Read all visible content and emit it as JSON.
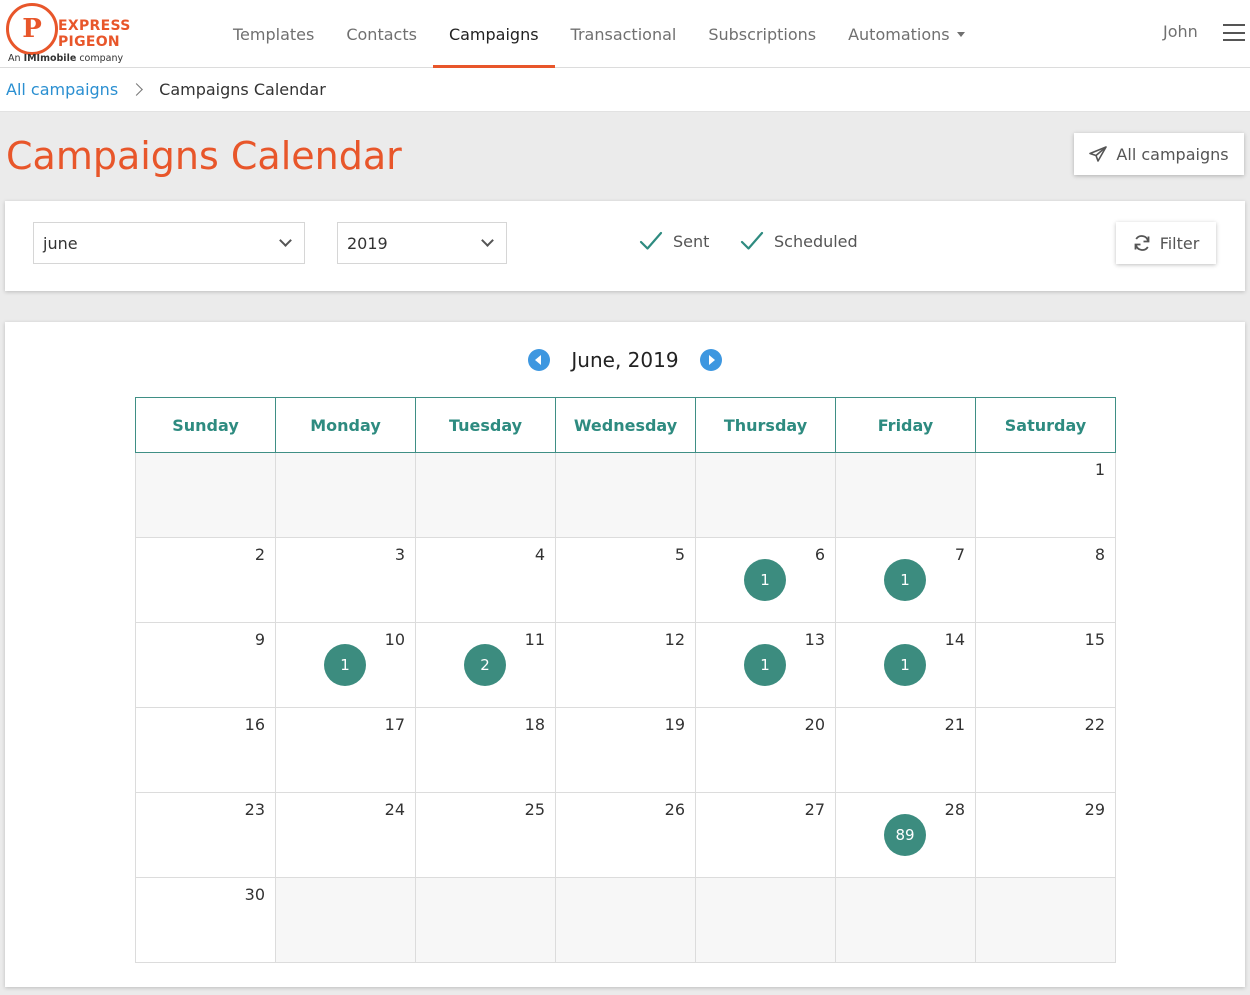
{
  "brand": {
    "logo_letter": "P",
    "line1": "EXPRESS",
    "line2": "PIGEON",
    "sub_prefix": "An",
    "sub_strong": "IMImobile",
    "sub_suffix": "company"
  },
  "nav": {
    "items": [
      {
        "label": "Templates",
        "active": false
      },
      {
        "label": "Contacts",
        "active": false
      },
      {
        "label": "Campaigns",
        "active": true
      },
      {
        "label": "Transactional",
        "active": false
      },
      {
        "label": "Subscriptions",
        "active": false
      },
      {
        "label": "Automations",
        "active": false,
        "dropdown": true
      }
    ],
    "user": "John"
  },
  "breadcrumb": {
    "link": "All campaigns",
    "current": "Campaigns Calendar"
  },
  "page": {
    "title": "Campaigns Calendar",
    "all_campaigns_button": "All campaigns"
  },
  "filters": {
    "month": "june",
    "year": "2019",
    "sent_label": "Sent",
    "sent_checked": true,
    "scheduled_label": "Scheduled",
    "scheduled_checked": true,
    "filter_button": "Filter"
  },
  "calendar": {
    "month_label": "June, 2019",
    "weekdays": [
      "Sunday",
      "Monday",
      "Tuesday",
      "Wednesday",
      "Thursday",
      "Friday",
      "Saturday"
    ],
    "weeks": [
      [
        null,
        null,
        null,
        null,
        null,
        null,
        {
          "day": "1"
        }
      ],
      [
        {
          "day": "2"
        },
        {
          "day": "3"
        },
        {
          "day": "4"
        },
        {
          "day": "5"
        },
        {
          "day": "6",
          "count": "1"
        },
        {
          "day": "7",
          "count": "1"
        },
        {
          "day": "8"
        }
      ],
      [
        {
          "day": "9"
        },
        {
          "day": "10",
          "count": "1"
        },
        {
          "day": "11",
          "count": "2"
        },
        {
          "day": "12"
        },
        {
          "day": "13",
          "count": "1"
        },
        {
          "day": "14",
          "count": "1"
        },
        {
          "day": "15"
        }
      ],
      [
        {
          "day": "16"
        },
        {
          "day": "17"
        },
        {
          "day": "18"
        },
        {
          "day": "19"
        },
        {
          "day": "20"
        },
        {
          "day": "21"
        },
        {
          "day": "22"
        }
      ],
      [
        {
          "day": "23"
        },
        {
          "day": "24"
        },
        {
          "day": "25"
        },
        {
          "day": "26"
        },
        {
          "day": "27"
        },
        {
          "day": "28",
          "count": "89"
        },
        {
          "day": "29"
        }
      ],
      [
        {
          "day": "30"
        },
        null,
        null,
        null,
        null,
        null,
        null
      ]
    ]
  },
  "colors": {
    "brand_orange": "#e8562a",
    "teal": "#3c8c7f",
    "link_blue": "#2a8fd1",
    "arrow_blue": "#3d97e0"
  },
  "icons": {
    "prev": "chevron-left-circle-icon",
    "next": "chevron-right-circle-icon",
    "send": "paper-plane-icon",
    "refresh": "refresh-icon",
    "check": "check-icon",
    "menu": "hamburger-menu-icon"
  }
}
